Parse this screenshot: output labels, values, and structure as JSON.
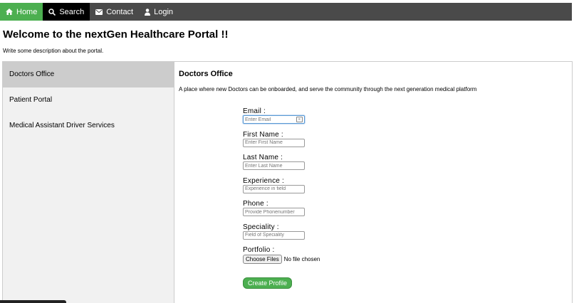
{
  "nav": {
    "items": [
      {
        "label": "Home",
        "icon": "home-icon"
      },
      {
        "label": "Search",
        "icon": "search-icon"
      },
      {
        "label": "Contact",
        "icon": "envelope-icon"
      },
      {
        "label": "Login",
        "icon": "user-icon"
      }
    ]
  },
  "header": {
    "title": "Welcome to the nextGen Healthcare Portal !!",
    "description": "Write some description about the portal."
  },
  "sidebar": {
    "items": [
      {
        "label": "Doctors Office",
        "active": true
      },
      {
        "label": "Patient Portal",
        "active": false
      },
      {
        "label": "Medical Assistant Driver Services",
        "active": false
      }
    ]
  },
  "main": {
    "title": "Doctors Office",
    "lead": "A place where new Doctors can be onboarded, and serve the community through the next generation medical platform",
    "fields": [
      {
        "label": "Email :",
        "placeholder": "Enter Email"
      },
      {
        "label": "First Name :",
        "placeholder": "Enter First Name"
      },
      {
        "label": "Last Name :",
        "placeholder": "Enter Last Name"
      },
      {
        "label": "Experience :",
        "placeholder": "Experience in field"
      },
      {
        "label": "Phone :",
        "placeholder": "Provide Phonenumber"
      },
      {
        "label": "Speciality :",
        "placeholder": "Field of Speciality"
      }
    ],
    "portfolio": {
      "label": "Portfolio :",
      "button_label": "Choose Files",
      "status": "No file chosen"
    },
    "submit_label": "Create Profile"
  },
  "colors": {
    "navbar": "#4a4a4a",
    "accent": "#4CAF50",
    "sidebar_bg": "#f1f1f1",
    "sidebar_active": "#cccccc"
  }
}
